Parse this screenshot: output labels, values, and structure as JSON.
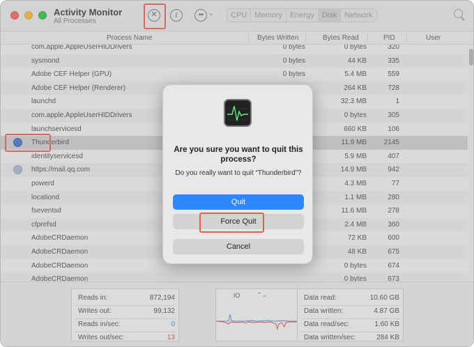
{
  "app": {
    "title": "Activity Monitor",
    "subtitle": "All Processes"
  },
  "toolbar": {
    "stop_icon": "stop-process-icon",
    "info_icon": "info-icon",
    "more_icon": "more-options-icon",
    "tabs": [
      {
        "label": "CPU"
      },
      {
        "label": "Memory"
      },
      {
        "label": "Energy"
      },
      {
        "label": "Disk",
        "active": true
      },
      {
        "label": "Network"
      }
    ]
  },
  "columns": {
    "process_name": "Process Name",
    "bytes_written": "Bytes Written",
    "bytes_read": "Bytes Read",
    "pid": "PID",
    "user": "User"
  },
  "rows": [
    {
      "name": "com.apple.AppleUserHIDDrivers",
      "bytes_written": "0 bytes",
      "bytes_read": "0 bytes",
      "pid": "320"
    },
    {
      "name": "sysmond",
      "bytes_written": "0 bytes",
      "bytes_read": "44 KB",
      "pid": "335"
    },
    {
      "name": "Adobe CEF Helper (GPU)",
      "bytes_written": "0 bytes",
      "bytes_read": "5.4 MB",
      "pid": "559"
    },
    {
      "name": "Adobe CEF Helper (Renderer)",
      "bytes_written": "0 bytes",
      "bytes_read": "264 KB",
      "pid": "728"
    },
    {
      "name": "launchd",
      "bytes_written": "",
      "bytes_read": "32.3 MB",
      "pid": "1"
    },
    {
      "name": "com.apple.AppleUserHIDDrivers",
      "bytes_written": "",
      "bytes_read": "0 bytes",
      "pid": "305"
    },
    {
      "name": "launchservicesd",
      "bytes_written": "",
      "bytes_read": "660 KB",
      "pid": "106"
    },
    {
      "name": "Thunderbird",
      "bytes_written": "",
      "bytes_read": "11.9 MB",
      "pid": "2145",
      "icon": "thunderbird-icon",
      "selected": true
    },
    {
      "name": "identityservicesd",
      "bytes_written": "",
      "bytes_read": "5.9 MB",
      "pid": "407"
    },
    {
      "name": "https://mail.qq.com",
      "bytes_written": "",
      "bytes_read": "14.9 MB",
      "pid": "942",
      "icon": "globe-icon"
    },
    {
      "name": "powerd",
      "bytes_written": "",
      "bytes_read": "4.3 MB",
      "pid": "77"
    },
    {
      "name": "locationd",
      "bytes_written": "",
      "bytes_read": "1.1 MB",
      "pid": "280"
    },
    {
      "name": "fseventsd",
      "bytes_written": "",
      "bytes_read": "11.6 MB",
      "pid": "278"
    },
    {
      "name": "cfprefsd",
      "bytes_written": "",
      "bytes_read": "2.4 MB",
      "pid": "360"
    },
    {
      "name": "AdobeCRDaemon",
      "bytes_written": "",
      "bytes_read": "72 KB",
      "pid": "600"
    },
    {
      "name": "AdobeCRDaemon",
      "bytes_written": "",
      "bytes_read": "48 KB",
      "pid": "675"
    },
    {
      "name": "AdobeCRDaemon",
      "bytes_written": "",
      "bytes_read": "0 bytes",
      "pid": "674"
    },
    {
      "name": "AdobeCRDaemon",
      "bytes_written": "",
      "bytes_read": "0 bytes",
      "pid": "673"
    }
  ],
  "stats_left": [
    {
      "label": "Reads in:",
      "value": "872,194",
      "color": "#444444"
    },
    {
      "label": "Writes out:",
      "value": "99,132",
      "color": "#444444"
    },
    {
      "label": "Reads in/sec:",
      "value": "0",
      "color": "#3b8fd8"
    },
    {
      "label": "Writes out/sec:",
      "value": "13",
      "color": "#d9473b"
    }
  ],
  "graph": {
    "label": "IO",
    "read_color": "#4a90d9",
    "write_color": "#d9473b"
  },
  "stats_right": [
    {
      "label": "Data read:",
      "value": "10.60 GB"
    },
    {
      "label": "Data written:",
      "value": "4.87 GB"
    },
    {
      "label": "Data read/sec:",
      "value": "1.60 KB"
    },
    {
      "label": "Data written/sec:",
      "value": "284 KB"
    }
  ],
  "dialog": {
    "icon": "activity-monitor-icon",
    "title": "Are you sure you want to quit this process?",
    "message": "Do you really want to quit “Thunderbird”?",
    "quit_label": "Quit",
    "force_quit_label": "Force Quit",
    "cancel_label": "Cancel"
  }
}
